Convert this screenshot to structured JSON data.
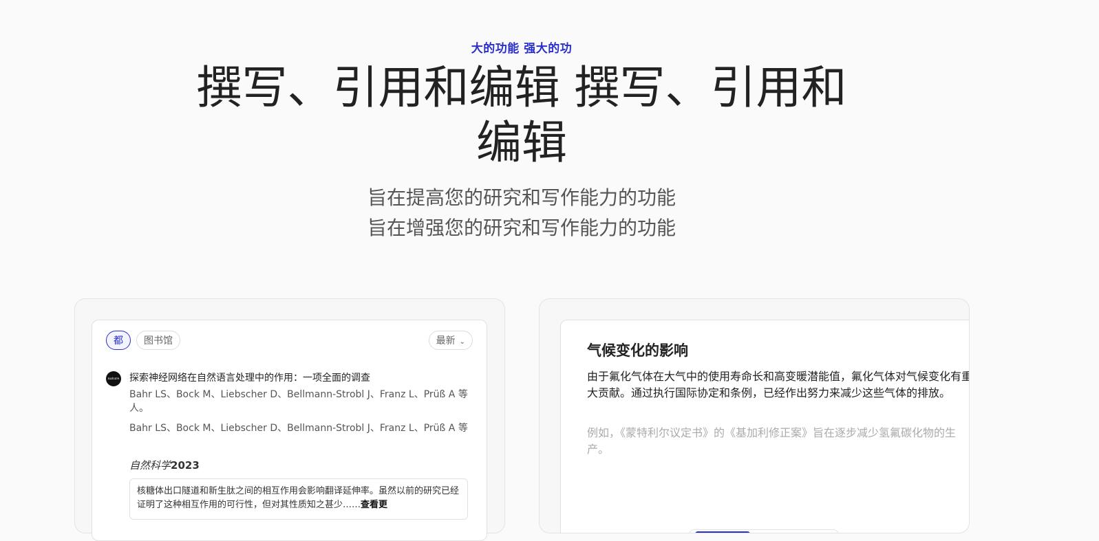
{
  "hero": {
    "eyebrow": "大的功能 强大的功",
    "headline": "撰写、引用和编辑 撰写、引用和编辑",
    "sub1": "旨在提高您的研究和写作能力的功能",
    "sub2": "旨在增强您的研究和写作能力的功能"
  },
  "library_card": {
    "filters": {
      "all": "都",
      "library": "图书馆"
    },
    "sort": {
      "label": "最新",
      "icon": "chevron-down-icon"
    },
    "item": {
      "logo_text": "nature",
      "title": "探索神经网络在自然语言处理中的作用：一项全面的调查",
      "authors_1": "Bahr LS、Bock M、Liebscher D、Bellmann-Strobl J、Franz L、Prüß A 等人。",
      "authors_2": "Bahr LS、Bock M、Liebscher D、Bellmann-Strobl J、Franz L、Prüß A 等",
      "journal": "自然科学",
      "year": "2023",
      "abstract": "核糖体出口隧道和新生肽之间的相互作用会影响翻译延伸率。虽然以前的研究已经证明了这种相互作用的可行性，但对其性质知之甚少……",
      "read_more": "查看更"
    }
  },
  "editor_card": {
    "title": "气候变化的影响",
    "para1": "由于氟化气体在大气中的使用寿命长和高变暖潜能值，氟化气体对气候变化有重大贡献。通过执行国际协定和条例，已经作出努力来减少这些气体的排放。",
    "para2": "例如，《蒙特利尔议定书》的《基加利修正案》旨在逐步减少氢氟碳化物的生产。"
  },
  "colors": {
    "accent": "#2a2fc9",
    "text": "#222222",
    "muted": "#aaaaaa"
  }
}
